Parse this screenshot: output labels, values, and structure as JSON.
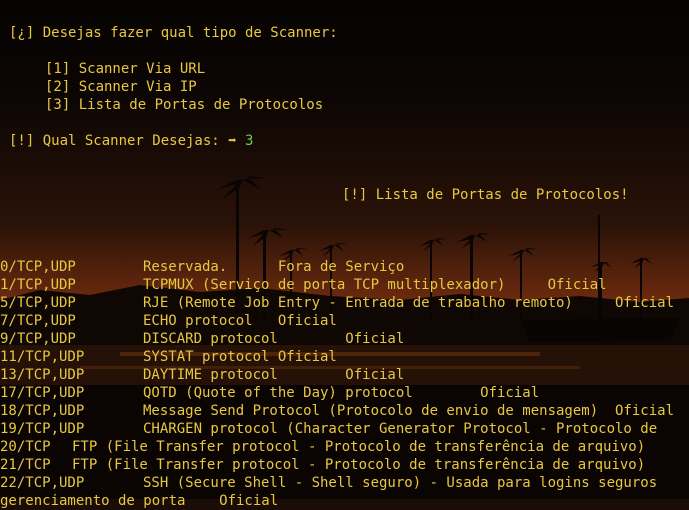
{
  "prompt": {
    "question": "[¿] Desejas fazer qual tipo de Scanner:",
    "options": [
      "[1] Scanner Via URL",
      "[2] Scanner Via IP",
      "[3] Lista de Portas de Protocolos"
    ],
    "choice_label": "[!] Qual Scanner Desejas: ",
    "choice_arrow": "➡",
    "choice_value": "3"
  },
  "list_header": "[!] Lista de Portas de Protocolos!",
  "ports": [
    {
      "port": "0/TCP,UDP",
      "desc": "Reservada.      Fora de Serviço"
    },
    {
      "port": "1/TCP,UDP",
      "desc": "TCPMUX (Serviço de porta TCP multiplexador)     Oficial"
    },
    {
      "port": "5/TCP,UDP",
      "desc": "RJE (Remote Job Entry - Entrada de trabalho remoto)     Oficial"
    },
    {
      "port": "7/TCP,UDP",
      "desc": "ECHO protocol   Oficial"
    },
    {
      "port": "9/TCP,UDP",
      "desc": "DISCARD protocol        Oficial"
    },
    {
      "port": "11/TCP,UDP",
      "desc": "SYSTAT protocol Oficial"
    },
    {
      "port": "13/TCP,UDP",
      "desc": "DAYTIME protocol        Oficial"
    },
    {
      "port": "17/TCP,UDP",
      "desc": "QOTD (Quote of the Day) protocol        Oficial"
    },
    {
      "port": "18/TCP,UDP",
      "desc": "Message Send Protocol (Protocolo de envio de mensagem)  Oficial"
    },
    {
      "port": "19/TCP,UDP",
      "desc": "CHARGEN protocol (Character Generator Protocol - Protocolo de"
    },
    {
      "port": "20/TCP",
      "desc": "FTP (File Transfer protocol - Protocolo de transferência de arquivo)"
    },
    {
      "port": "21/TCP",
      "desc": "FTP (File Transfer protocol - Protocolo de transferência de arquivo)"
    },
    {
      "port": "22/TCP,UDP",
      "desc": "SSH (Secure Shell - Shell seguro) - Usada para logins seguros"
    }
  ],
  "trailing_line": "gerenciamento de porta    Oficial",
  "colors": {
    "text": "#e8c840",
    "answer": "#6fd14a"
  }
}
